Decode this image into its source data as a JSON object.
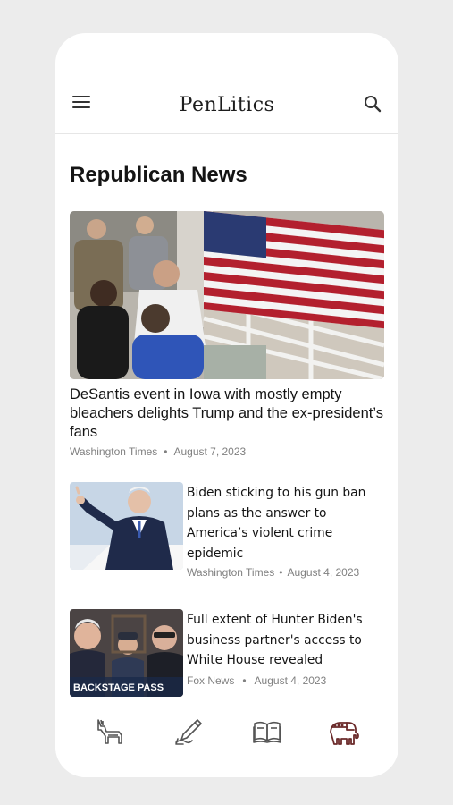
{
  "app": {
    "brand": "PenLitics"
  },
  "header": {
    "menu_icon": "hamburger-icon",
    "search_icon": "search-icon"
  },
  "page": {
    "title": "Republican News"
  },
  "featured": {
    "title": "DeSantis event in Iowa with mostly empty bleachers delights Trump and the ex-president’s fans",
    "source": "Washington Times",
    "separator": "•",
    "date": "August 7, 2023"
  },
  "articles": [
    {
      "title": "Biden sticking to his gun ban plans as the answer to America’s violent crime epidemic",
      "source": "Washington Times",
      "separator": "•",
      "date": "August 4, 2023"
    },
    {
      "title": "Full extent of Hunter Biden's business partner's access to White House revealed",
      "source": "Fox News",
      "separator": "•",
      "date": "August 4, 2023",
      "image_caption": "BACKSTAGE PASS"
    }
  ],
  "bottom_nav": {
    "items": [
      "donkey-icon",
      "pen-icon",
      "book-icon",
      "elephant-icon"
    ],
    "active": "elephant-icon",
    "active_color": "#6b2b2b",
    "inactive_color": "#555555"
  }
}
